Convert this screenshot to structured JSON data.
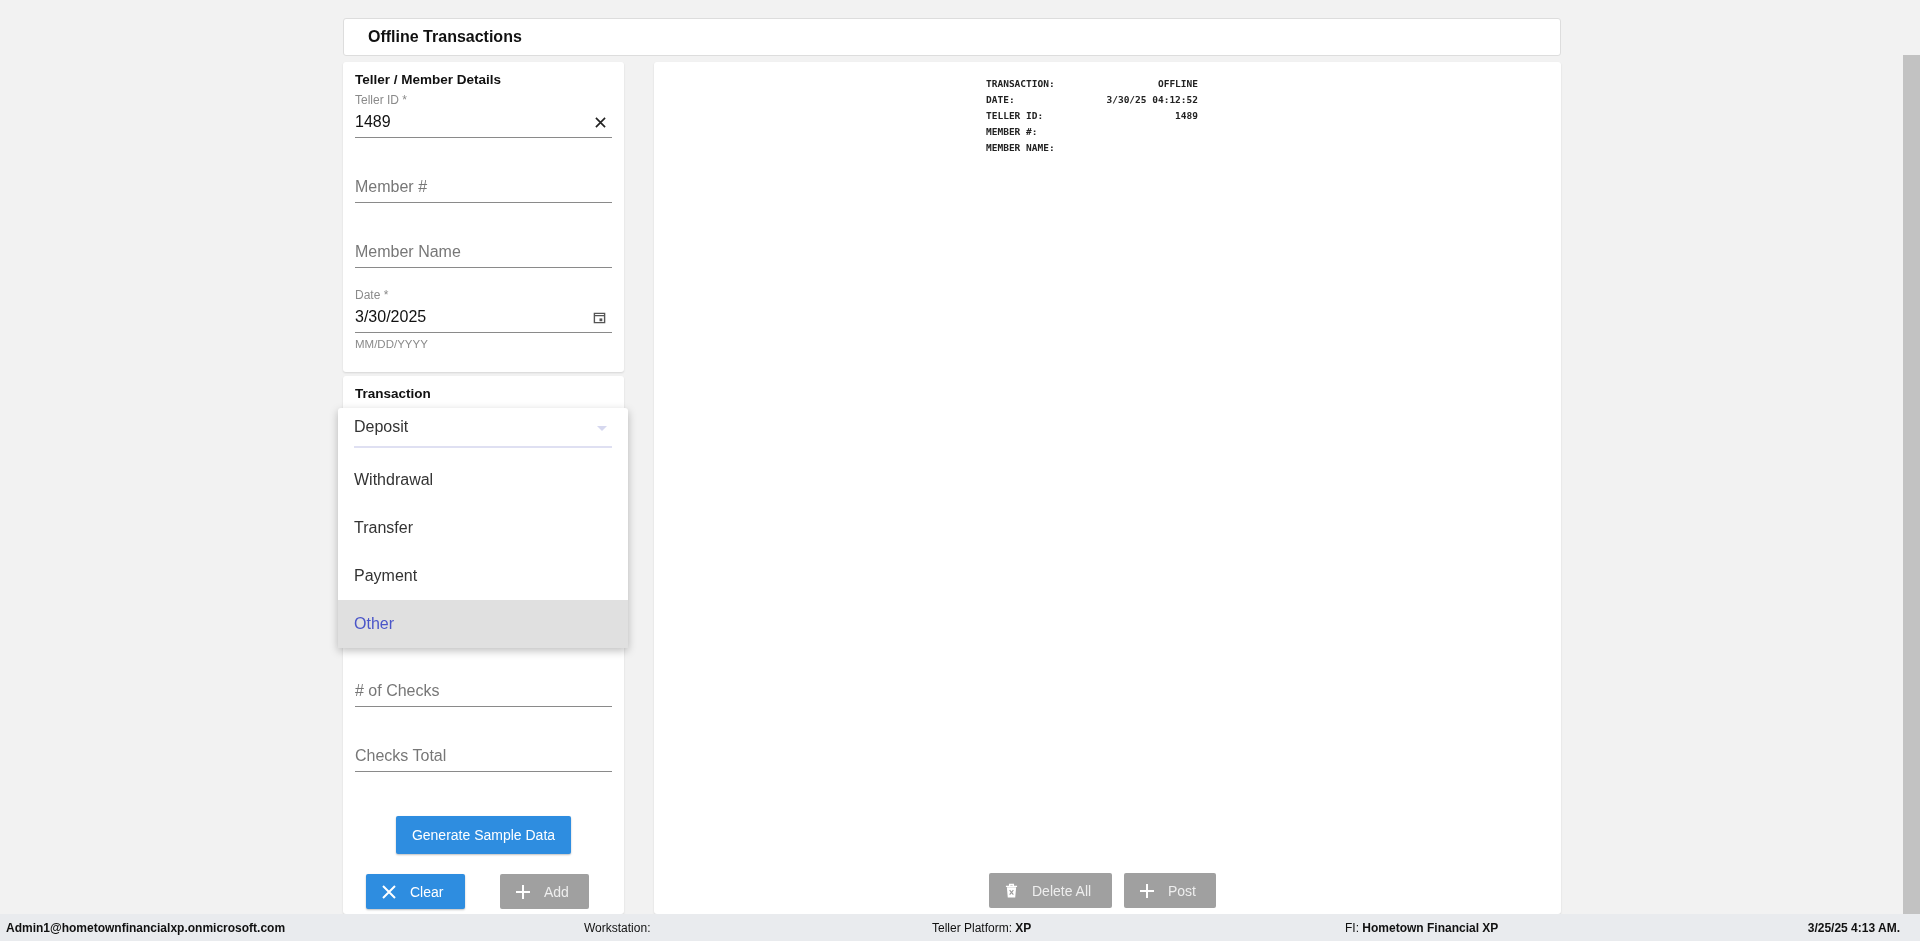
{
  "header": {
    "title": "Offline Transactions"
  },
  "member_details": {
    "title": "Teller / Member Details",
    "fields": [
      {
        "kind": "text",
        "label": "Teller ID *",
        "value": "1489",
        "clearable": true
      },
      {
        "kind": "text",
        "placeholder": "Member #"
      },
      {
        "kind": "text",
        "placeholder": "Member Name"
      },
      {
        "kind": "date",
        "label": "Date *",
        "value": "3/30/2025",
        "hint": "MM/DD/YYYY"
      }
    ]
  },
  "transaction": {
    "title": "Transaction",
    "fields": [
      {
        "placeholder": "# of Checks"
      },
      {
        "placeholder": "Checks Total"
      }
    ],
    "dropdown": {
      "items": [
        {
          "label": "Deposit",
          "selected": false
        },
        {
          "label": "Withdrawal",
          "selected": false
        },
        {
          "label": "Transfer",
          "selected": false
        },
        {
          "label": "Payment",
          "selected": false
        },
        {
          "label": "Other",
          "selected": true
        }
      ]
    },
    "generate_button": "Generate Sample Data",
    "buttons": [
      {
        "label": "Clear",
        "kind": "clear",
        "disabled": false
      },
      {
        "label": "Add",
        "kind": "add",
        "disabled": true
      }
    ]
  },
  "receipt": {
    "lines": [
      {
        "label": "TRANSACTION:",
        "value": "OFFLINE"
      },
      {
        "label": "DATE:",
        "value": "3/30/25 04:12:52"
      },
      {
        "label": "TELLER ID:",
        "value": "1489"
      },
      {
        "label": "MEMBER #:"
      },
      {
        "label": "MEMBER NAME:"
      }
    ],
    "buttons": [
      {
        "label": "Delete All",
        "kind": "delete",
        "disabled": true
      },
      {
        "label": "Post",
        "kind": "add",
        "disabled": true
      }
    ]
  },
  "status_bar": {
    "user": "Admin1@hometownfinancialxp.onmicrosoft.com",
    "workstation_label": "Workstation:",
    "platform_label": "Teller Platform:",
    "platform": "XP",
    "fi_label": "FI:",
    "fi": "Hometown Financial XP",
    "datetime": "3/25/25 4:13 AM."
  }
}
